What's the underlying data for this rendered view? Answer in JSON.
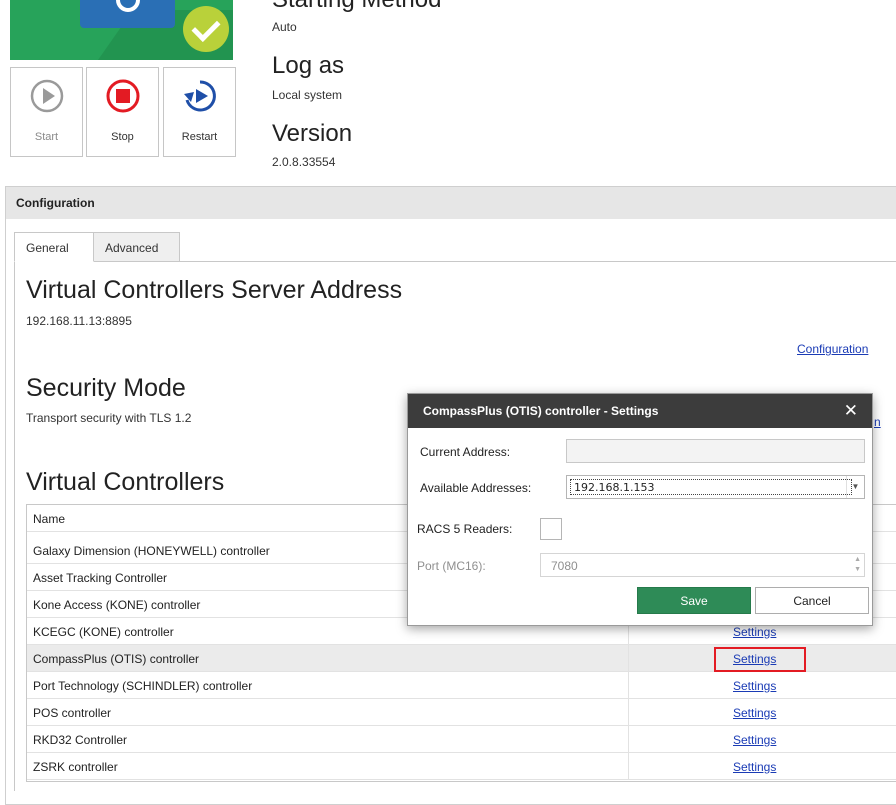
{
  "service": {
    "buttons": [
      {
        "label": "Start"
      },
      {
        "label": "Stop"
      },
      {
        "label": "Restart"
      }
    ],
    "starting_method": {
      "title": "Starting Method",
      "value": "Auto"
    },
    "log_as": {
      "title": "Log as",
      "value": "Local system"
    },
    "version": {
      "title": "Version",
      "value": "2.0.8.33554"
    }
  },
  "configuration": {
    "header": "Configuration",
    "tabs": [
      {
        "label": "General"
      },
      {
        "label": "Advanced"
      }
    ],
    "server_address": {
      "title": "Virtual Controllers Server Address",
      "value": "192.168.11.13:8895"
    },
    "configuration_link": "Configuration",
    "security_mode": {
      "title": "Security Mode",
      "value": "Transport security with TLS 1.2"
    },
    "partial_link": "n",
    "controllers_title": "Virtual Controllers",
    "grid": {
      "column_name": "Name",
      "rows": [
        {
          "name": "Galaxy Dimension (HONEYWELL) controller",
          "action": ""
        },
        {
          "name": "Asset Tracking Controller",
          "action": ""
        },
        {
          "name": "Kone Access (KONE) controller",
          "action": ""
        },
        {
          "name": "KCEGC (KONE) controller",
          "action": "Settings"
        },
        {
          "name": "CompassPlus (OTIS) controller",
          "action": "Settings",
          "selected": true
        },
        {
          "name": "Port Technology (SCHINDLER) controller",
          "action": "Settings"
        },
        {
          "name": "POS controller",
          "action": "Settings"
        },
        {
          "name": "RKD32 Controller",
          "action": "Settings"
        },
        {
          "name": "ZSRK controller",
          "action": "Settings"
        }
      ]
    }
  },
  "dialog": {
    "title": "CompassPlus (OTIS) controller - Settings",
    "close_glyph": "✕",
    "current_address_label": "Current Address:",
    "current_address_value": "",
    "available_addresses_label": "Available Addresses:",
    "available_addresses_value": "192.168.1.153",
    "racs_label": "RACS 5 Readers:",
    "port_label": "Port (MC16):",
    "port_value": "7080",
    "save_label": "Save",
    "cancel_label": "Cancel"
  },
  "colors": {
    "accent_green": "#2e8b57",
    "highlight_red": "#e31b23",
    "link_blue": "#1a3bb5",
    "dialog_titlebar": "#3c3c3c"
  }
}
